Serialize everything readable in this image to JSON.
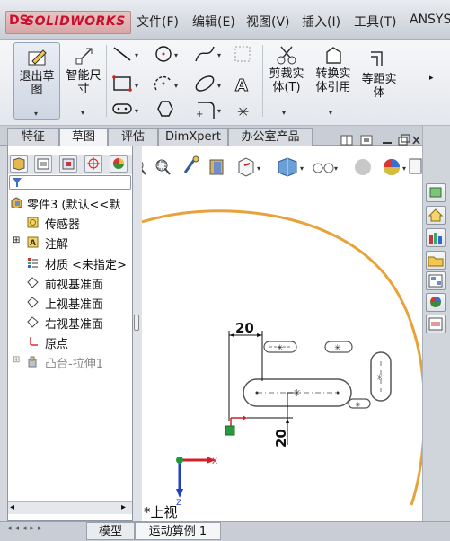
{
  "app": {
    "logo_mark": "DS",
    "logo_text": "SOLIDWORKS"
  },
  "menu": [
    "文件(F)",
    "编辑(E)",
    "视图(V)",
    "插入(I)",
    "工具(T)",
    "ANSYS"
  ],
  "ribbon": {
    "exit_sketch": "退出草图",
    "smart_dimension": "智能尺寸",
    "trim_line1": "剪裁实",
    "trim_line2": "体(T)",
    "convert_line1": "转换实",
    "convert_line2": "体引用",
    "offset_line1": "等距实",
    "offset_line2": "体"
  },
  "tabs": [
    "特征",
    "草图",
    "评估",
    "DimXpert",
    "办公室产品"
  ],
  "active_tab": "草图",
  "feature_tree": {
    "root": "零件3 (默认<<默",
    "items": [
      "传感器",
      "注解",
      "材质 <未指定>",
      "前视基准面",
      "上视基准面",
      "右视基准面",
      "原点",
      "凸台-拉伸1"
    ]
  },
  "sketch": {
    "dim_horizontal": "20",
    "dim_vertical": "20",
    "view_label": "*上视",
    "axis_x": "X",
    "axis_z": "Z"
  },
  "bottom_tabs": [
    "模型",
    "运动算例 1"
  ],
  "colors": {
    "brand": "#c8102e",
    "circle": "#e8a23a",
    "axis_x": "#d0202a",
    "axis_y": "#1f9a3a",
    "axis_z": "#2040c0"
  }
}
